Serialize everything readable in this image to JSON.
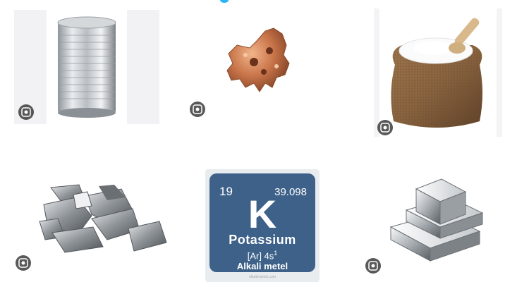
{
  "results": [
    {
      "name": "tin-can",
      "subject": "Tin can"
    },
    {
      "name": "copper-nugget",
      "subject": "Copper nugget"
    },
    {
      "name": "salt-sack",
      "subject": "Sack of salt"
    },
    {
      "name": "metal-chunks",
      "subject": "Metal chunks"
    },
    {
      "name": "potassium-card",
      "subject": "Potassium periodic card"
    },
    {
      "name": "silver-bars",
      "subject": "Silver bars"
    }
  ],
  "element_card": {
    "atomic_number": "19",
    "atomic_mass": "39.098",
    "symbol": "K",
    "name": "Potassium",
    "configuration_base": "[Ar] 4s",
    "configuration_sup": "1",
    "category": "Alkali metel",
    "credit": "shutterstock.com"
  },
  "icons": {
    "visual_search": "lens-icon",
    "loading_indicator": "dot"
  },
  "colors": {
    "card_blue": "#3d6189",
    "indicator": "#29b6f6",
    "lens_bg": "#3c3c3c"
  }
}
